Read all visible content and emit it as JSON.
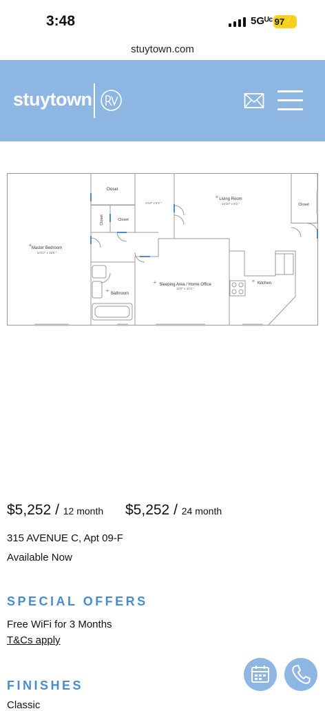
{
  "status_bar": {
    "time": "3:48",
    "network": "5Gᵁᶜ",
    "battery": "97"
  },
  "browser": {
    "url": "stuytown.com"
  },
  "header": {
    "logo_text": "stuytown",
    "mail_icon": "mail-icon",
    "menu_icon": "hamburger-menu-icon"
  },
  "floor_plan": {
    "rooms": {
      "master_bedroom": "Master Bedroom",
      "master_bedroom_dim": "10'10\" x 16'8 \"",
      "closet_top": "Closet",
      "closet_vertical": "Closet",
      "closet_small": "Closet",
      "hall_dim": "5'10\" x 8'2 \"",
      "living_room": "Living Room",
      "living_room_dim": "14'10\" x 8'2 \"",
      "closet_right": "Closet",
      "bathroom": "Bathroom",
      "sleeping_area": "Sleeping Area / Home Office",
      "sleeping_area_dim": "12'0\" x 10'4 \"",
      "kitchen": "Kitchen"
    }
  },
  "listing": {
    "price_12": "$5,252",
    "term_12": "12 month",
    "price_24": "$5,252",
    "term_24": "24 month",
    "separator": "/",
    "address": "315 AVENUE C, Apt 09-F",
    "availability": "Available Now"
  },
  "special_offers": {
    "heading": "SPECIAL OFFERS",
    "offer": "Free WiFi for 3 Months",
    "terms_link": "T&Cs apply"
  },
  "finishes": {
    "heading": "FINISHES",
    "value": "Classic"
  },
  "actions": {
    "calendar_icon": "calendar-icon",
    "phone_icon": "phone-icon"
  },
  "colors": {
    "header_bg": "#8db6e2",
    "accent": "#4a8bd0",
    "battery": "#f5d21d"
  }
}
